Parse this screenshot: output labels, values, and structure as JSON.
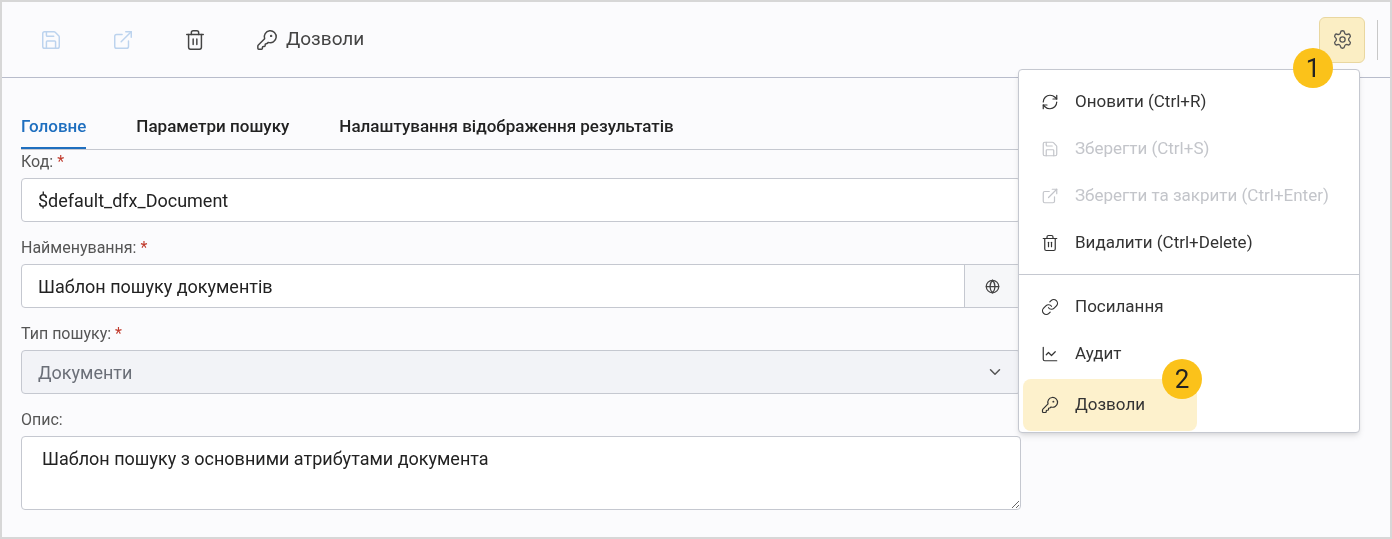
{
  "toolbar": {
    "buttons": [
      {
        "disabled": true
      },
      {
        "disabled": true
      },
      {
        "disabled": false
      },
      {
        "label": "Дозволи",
        "disabled": false
      }
    ],
    "settings": {
      "highlighted": true,
      "callout": "1"
    }
  },
  "tabs": [
    {
      "label": "Головне",
      "selected": true
    },
    {
      "label": "Параметри пошуку",
      "selected": false
    },
    {
      "label": "Налаштування відображення результатів",
      "selected": false
    }
  ],
  "fields": [
    {
      "kind": "text",
      "label": "Код:",
      "required_mark": "*",
      "value": "$default_dfx_Document"
    },
    {
      "kind": "translatable",
      "label": "Найменування:",
      "required_mark": "*",
      "value": "Шаблон пошуку документів"
    },
    {
      "kind": "select",
      "label": "Тип пошуку:",
      "required_mark": "*",
      "value": "Документи",
      "disabled": true
    },
    {
      "kind": "textarea",
      "label": "Опис:",
      "value": "Шаблон пошуку з основними атрибутами документа"
    }
  ],
  "menu": {
    "groups": [
      [
        {
          "label": "Оновити (Ctrl+R)",
          "disabled": false,
          "highlighted": false
        },
        {
          "label": "Зберегти (Ctrl+S)",
          "disabled": true,
          "highlighted": false
        },
        {
          "label": "Зберегти та закрити (Ctrl+Enter)",
          "disabled": true,
          "highlighted": false
        },
        {
          "label": "Видалити (Ctrl+Delete)",
          "disabled": false,
          "highlighted": false
        }
      ],
      [
        {
          "label": "Посилання",
          "disabled": false,
          "highlighted": false
        },
        {
          "label": "Аудит",
          "disabled": false,
          "highlighted": false
        },
        {
          "label": "Дозволи",
          "disabled": false,
          "highlighted": true,
          "callout": "2"
        }
      ]
    ]
  }
}
